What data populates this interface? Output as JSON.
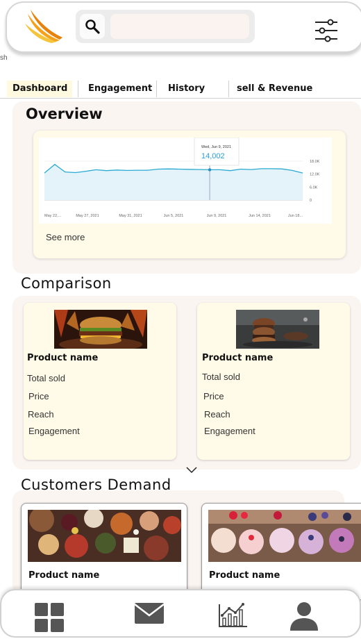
{
  "header": {
    "search": {
      "placeholder": "",
      "value": "",
      "icon": "search-icon"
    },
    "filter_icon": "sliders-icon",
    "stray_text": "sh"
  },
  "tabs": [
    {
      "label": "Dashboard",
      "active": true
    },
    {
      "label": "Engagement",
      "active": false
    },
    {
      "label": "History",
      "active": false
    },
    {
      "label": "sell & Revenue",
      "active": false
    }
  ],
  "overview": {
    "title": "Overview",
    "see_more": "See more",
    "chart_data": {
      "type": "area",
      "x": [
        "May 22,...",
        "May 27, 2021",
        "May 31, 2021",
        "Jun 5, 2021",
        "Jun 9, 2021",
        "Jun 14, 2021",
        "Jun 18..."
      ],
      "y_ticks": [
        "18.0K",
        "12.0K",
        "6.0K",
        "0"
      ],
      "ylim": [
        0,
        18000
      ],
      "series": [
        {
          "values": [
            12500,
            16500,
            13000,
            12700,
            13300,
            14000,
            13600,
            13900,
            13700,
            13800,
            13800,
            14300,
            14400,
            14300,
            14200,
            14100,
            14002,
            14000,
            13600,
            14300,
            14100,
            14500,
            14500,
            14400,
            13700,
            12500
          ]
        }
      ],
      "tooltip": {
        "date": "Wed, Jun 9, 2021",
        "value": "14,002"
      },
      "color": "#2aaad2"
    }
  },
  "comparison": {
    "title": "Comparison",
    "products": [
      {
        "name": "Product name",
        "fields": [
          "Total sold",
          "Price",
          "Reach",
          "Engagement"
        ]
      },
      {
        "name": "Product name",
        "fields": [
          "Total sold",
          "Price",
          "Reach",
          "Engagement"
        ]
      }
    ]
  },
  "customers_demand": {
    "title": "Customers Demand",
    "products": [
      {
        "name": "Product name"
      },
      {
        "name": "Product name"
      }
    ]
  },
  "bottom_nav": [
    {
      "icon": "dashboard-grid-icon"
    },
    {
      "icon": "mail-icon"
    },
    {
      "icon": "analytics-chart-icon"
    },
    {
      "icon": "profile-icon"
    }
  ]
}
